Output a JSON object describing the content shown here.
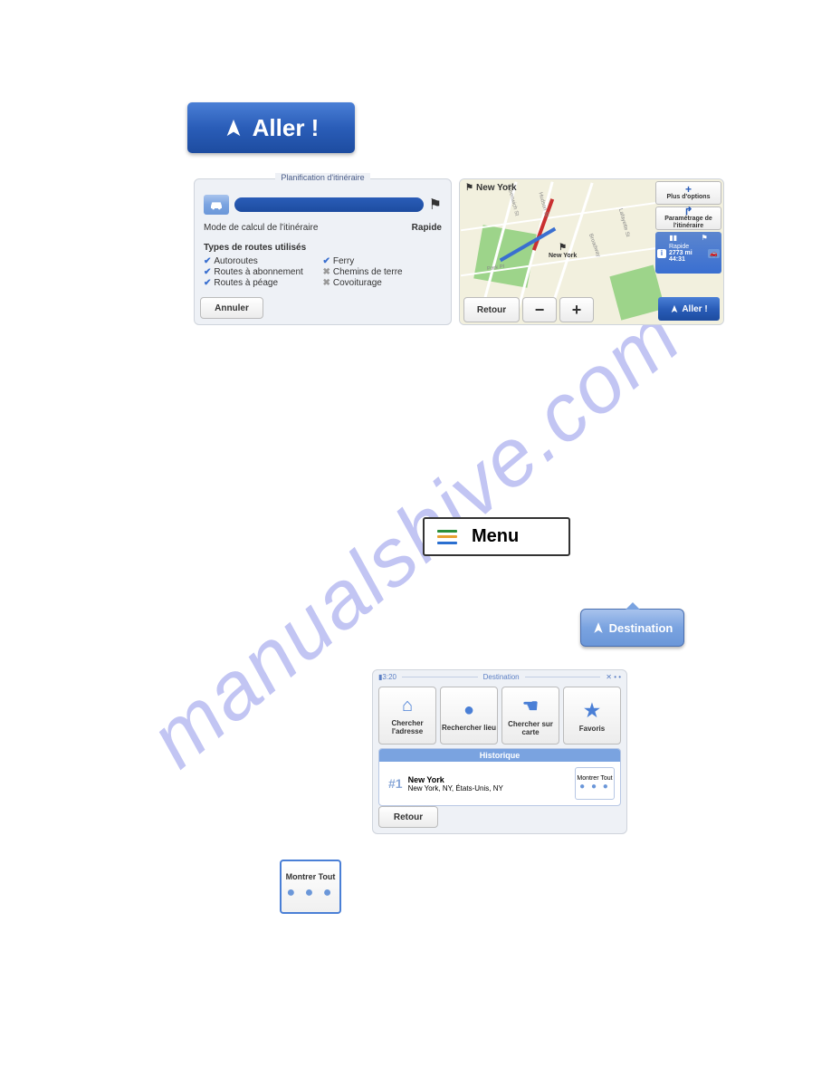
{
  "aller_button": "Aller !",
  "screen_plan": {
    "title": "Planification d'itinéraire",
    "mode_label": "Mode de calcul de l'itinéraire",
    "mode_value": "Rapide",
    "types_heading": "Types de routes utilisés",
    "types_col1": [
      {
        "check": true,
        "label": "Autoroutes"
      },
      {
        "check": true,
        "label": "Routes à abonnement"
      },
      {
        "check": true,
        "label": "Routes à péage"
      }
    ],
    "types_col2": [
      {
        "check": true,
        "label": "Ferry"
      },
      {
        "check": false,
        "label": "Chemins de terre"
      },
      {
        "check": false,
        "label": "Covoiturage"
      }
    ],
    "cancel": "Annuler"
  },
  "screen_map": {
    "city": "New York",
    "pin_label": "New York",
    "streets": [
      "Greenwich St",
      "Hudson St",
      "Broadway",
      "Lafayette St",
      "Park Pl"
    ],
    "plus_options": "Plus d'options",
    "route_settings": "Paramétrage de l'itinéraire",
    "info_mode": "Rapide",
    "info_dist": "2773 mi",
    "info_time": "44:31",
    "back": "Retour",
    "go": "Aller !"
  },
  "menu_button": "Menu",
  "destination_button": "Destination",
  "screen_dest": {
    "time": "3:20",
    "title": "Destination",
    "tiles": [
      {
        "icon": "home-icon",
        "label": "Chercher l'adresse"
      },
      {
        "icon": "pin-icon",
        "label": "Rechercher lieu"
      },
      {
        "icon": "hand-icon",
        "label": "Chercher sur carte"
      },
      {
        "icon": "star-icon",
        "label": "Favoris"
      }
    ],
    "history_heading": "Historique",
    "history_num": "#1",
    "history_name": "New York",
    "history_detail": "New York, NY, États-Unis, NY",
    "show_all_small": "Montrer Tout",
    "back": "Retour"
  },
  "show_all_big": "Montrer Tout"
}
